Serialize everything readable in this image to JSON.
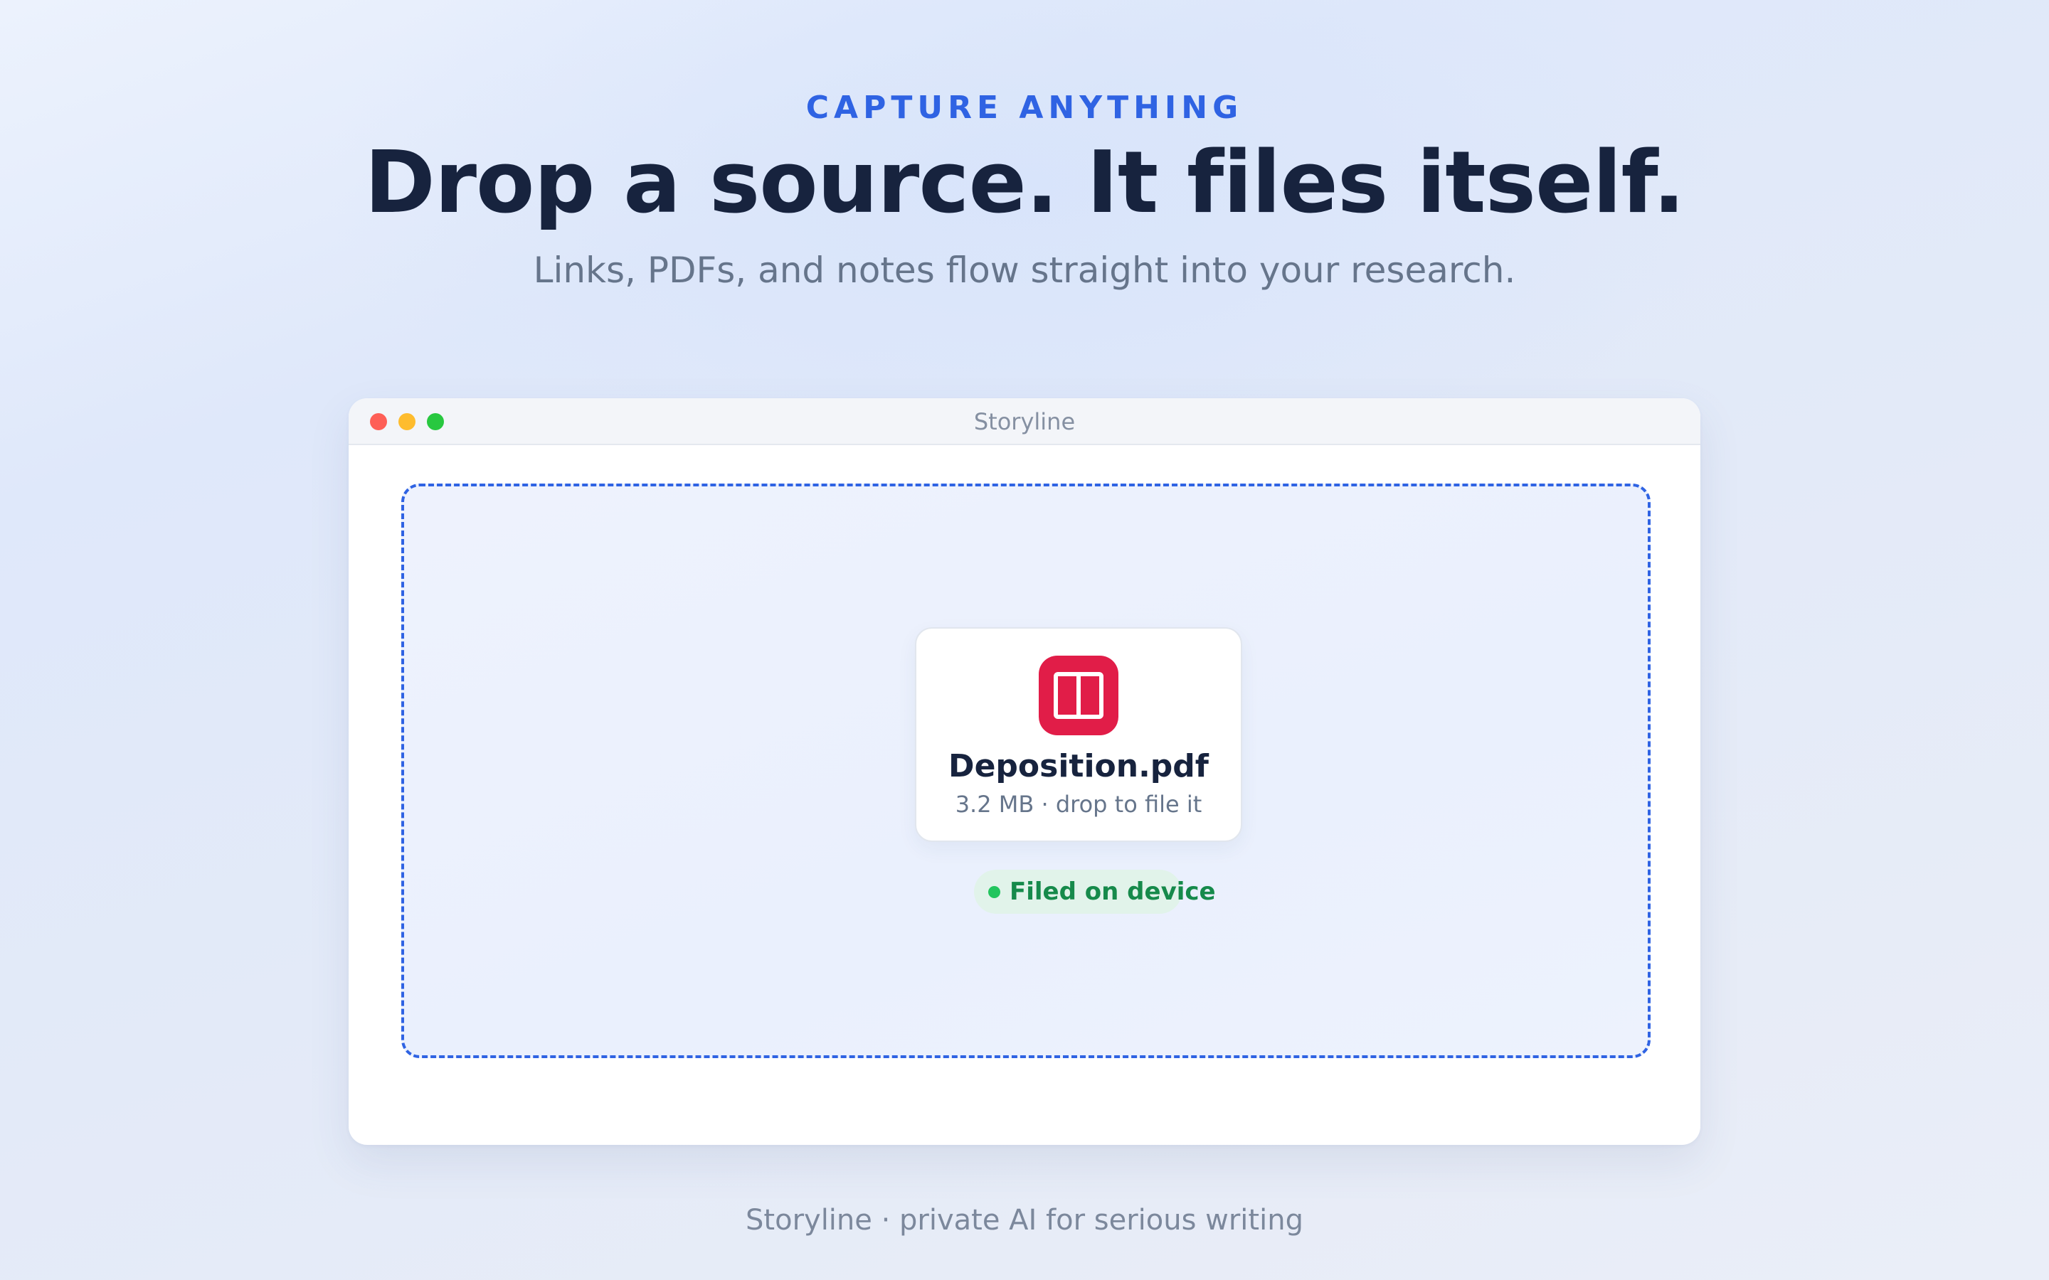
{
  "hero": {
    "eyebrow": "CAPTURE ANYTHING",
    "headline": "Drop a source. It files itself.",
    "subheadline": "Links, PDFs, and notes flow straight into your research."
  },
  "window": {
    "title": "Storyline",
    "traffic_lights": [
      "close",
      "minimize",
      "zoom"
    ]
  },
  "dropzone": {
    "file": {
      "icon": "book-icon",
      "name": "Deposition.pdf",
      "meta": "3.2 MB · drop to file it"
    },
    "status": {
      "label": "Filed on device"
    }
  },
  "footer": {
    "text": "Storyline · private AI for serious writing"
  },
  "colors": {
    "accent": "#2f63e3",
    "headline": "#17233e",
    "file_icon_bg": "#e11d48",
    "status_green": "#22c55e",
    "status_text": "#168a4b",
    "traffic_red": "#fe5f57",
    "traffic_yellow": "#febc2e",
    "traffic_green": "#28c840"
  }
}
